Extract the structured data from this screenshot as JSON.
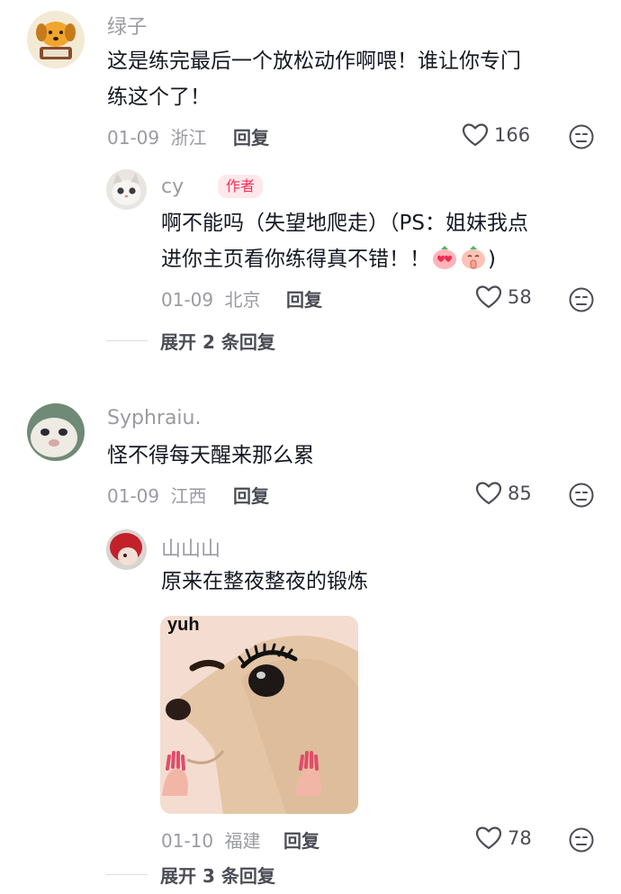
{
  "comments": [
    {
      "author": "绿子",
      "text_line1": "这是练完最后一个放松动作啊喂！谁让你专门",
      "text_line2": "练这个了！",
      "date": "01-09",
      "location": "浙江",
      "reply_label": "回复",
      "likes": "166",
      "replies": [
        {
          "author": "cy",
          "badge": "作者",
          "text_line1": "啊不能吗（失望地爬走）（PS：姐妹我点",
          "text_line2": "进你主页看你练得真不错！！",
          "text_tail": ")",
          "emojis": [
            "heart-eyes-peach-emoji",
            "praying-peach-emoji"
          ],
          "date": "01-09",
          "location": "北京",
          "reply_label": "回复",
          "likes": "58"
        }
      ],
      "expand_label": "展开 2 条回复"
    },
    {
      "author": "Syphraiu.",
      "text_line1": "怪不得每天醒来那么累",
      "date": "01-09",
      "location": "江西",
      "reply_label": "回复",
      "likes": "85",
      "replies": [
        {
          "author": "山山山",
          "text_line1": "原来在整夜整夜的锻炼",
          "sticker_caption": "yuh",
          "date": "01-10",
          "location": "福建",
          "reply_label": "回复",
          "likes": "78"
        }
      ],
      "expand_label": "展开 3 条回复"
    }
  ],
  "colors": {
    "meta_gray": "#9a9ba1",
    "text_dark": "#161823",
    "author_badge": "#fe2c55"
  }
}
